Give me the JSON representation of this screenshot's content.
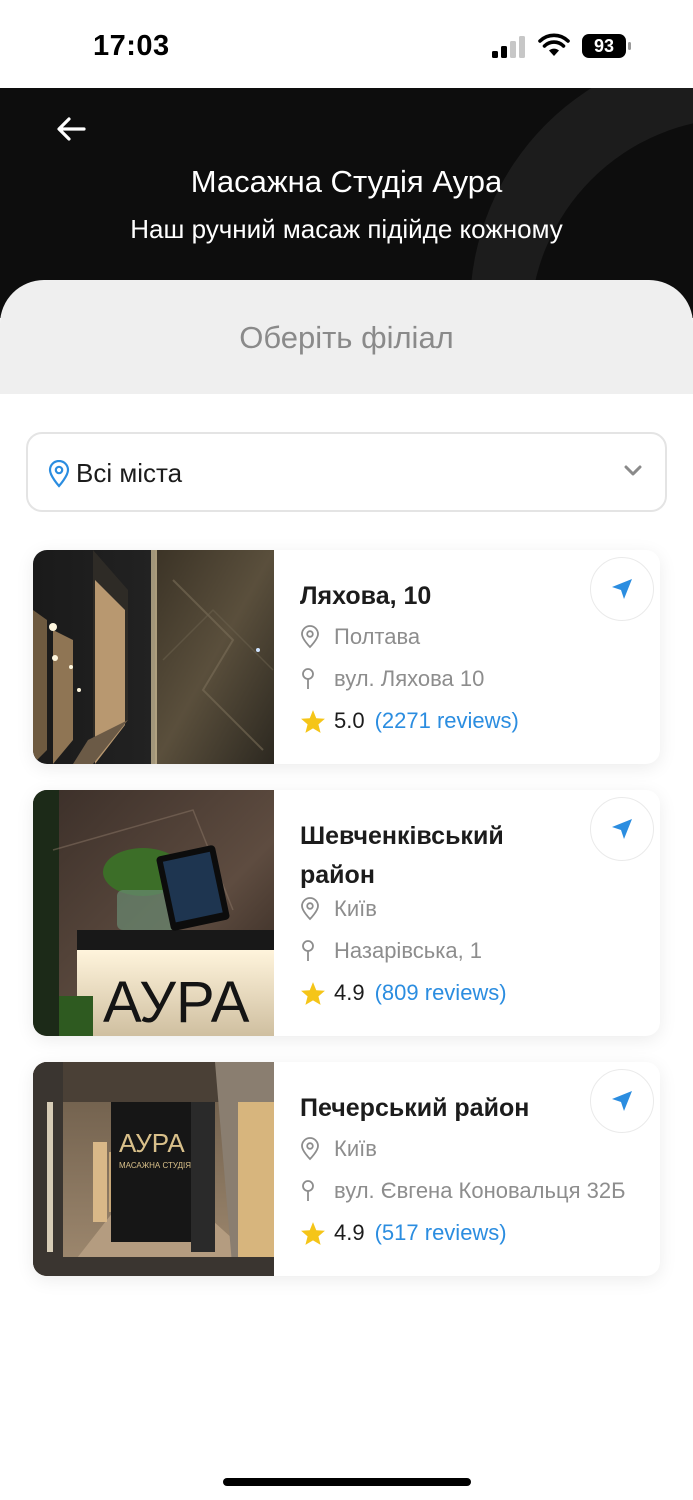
{
  "status_bar": {
    "time": "17:03",
    "battery": "93"
  },
  "header": {
    "title": "Масажна Студія Аура",
    "subtitle": "Наш ручний масаж підійде кожному"
  },
  "branch_section": {
    "title": "Оберіть філіал"
  },
  "city_filter": {
    "selected": "Всі міста"
  },
  "branches": [
    {
      "name": "Ляхова, 10",
      "city": "Полтава",
      "address": "вул. Ляхова 10",
      "rating": "5.0",
      "reviews": "(2271 reviews)"
    },
    {
      "name": "Шевченківський район",
      "city": "Київ",
      "address": "Назарівська, 1",
      "rating": "4.9",
      "reviews": "(809 reviews)"
    },
    {
      "name": "Печерський район",
      "city": "Київ",
      "address": "вул. Євгена Коновальця 32Б",
      "rating": "4.9",
      "reviews": "(517 reviews)"
    }
  ],
  "photo_signage": {
    "brand": "АУРА",
    "tagline": "МАСАЖНА СТУДІЯ"
  },
  "colors": {
    "accent": "#2b8de0",
    "star": "#f5c518",
    "header_bg": "#0d0d0d"
  }
}
